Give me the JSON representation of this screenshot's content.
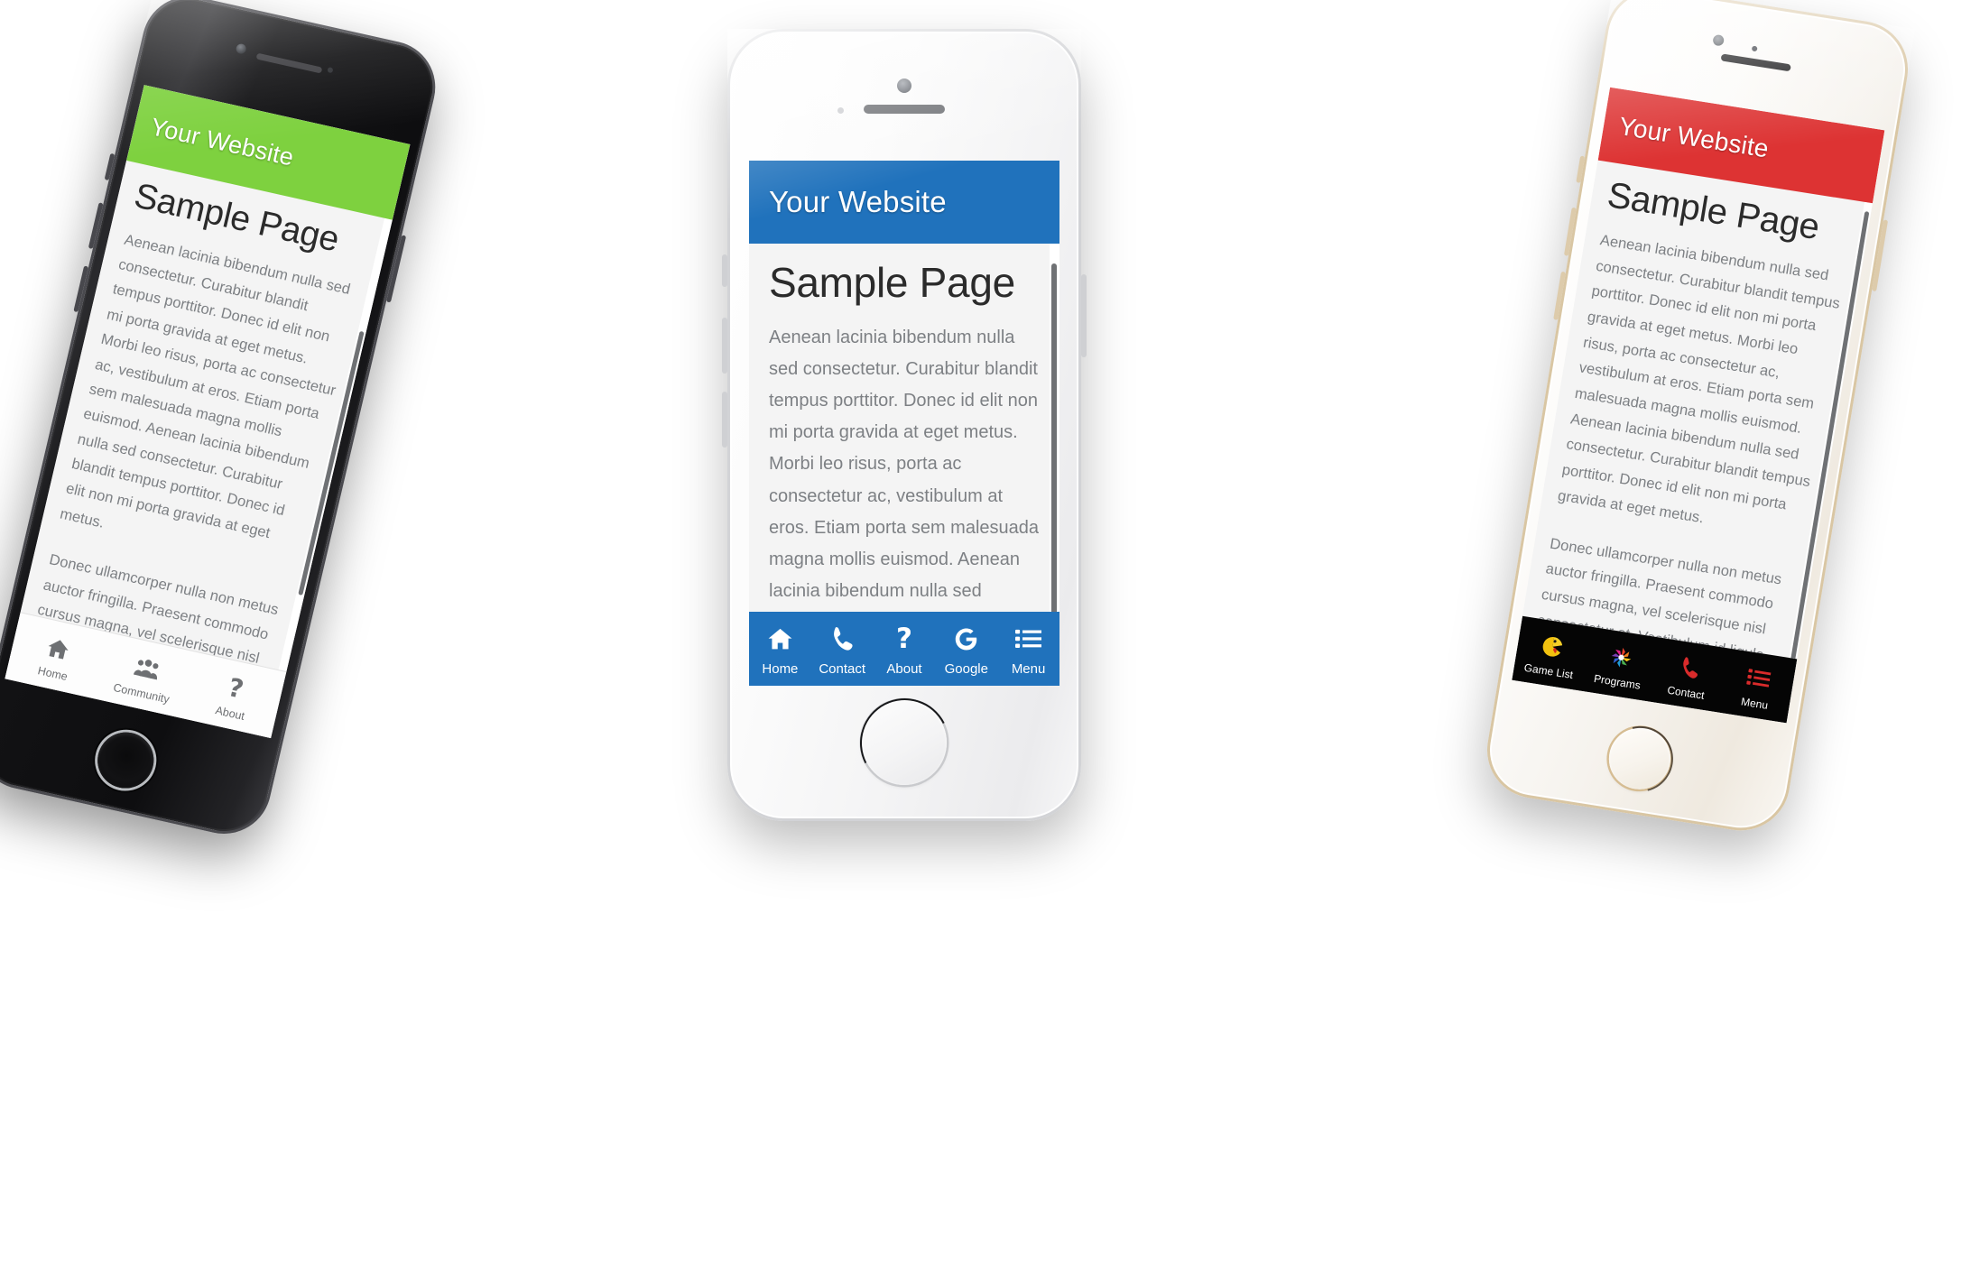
{
  "shared": {
    "site_title": "Your Website",
    "page_heading": "Sample Page",
    "paragraph_1": "Aenean lacinia bibendum nulla sed consectetur. Curabitur blandit tempus porttitor. Donec id elit non mi porta gravida at eget metus. Morbi leo risus, porta ac consectetur ac, vestibulum at eros. Etiam porta sem malesuada magna mollis euismod. Aenean lacinia bibendum nulla sed consectetur. Curabitur blandit tempus porttitor. Donec id elit non mi porta gravida at eget metus.",
    "paragraph_2": "Donec ullamcorper nulla non metus auctor fringilla. Praesent commodo cursus magna, vel scelerisque nisl consectetur et. Vestibulum id ligula porta felis euismod semper. Integer posuere erat a ante venenatis dapibus posuere velit aliquet. Donec id elit non mi porta gravida at eget metus."
  },
  "phones": {
    "left": {
      "device_name": "iPhone Space Gray",
      "device_color": "#1a1a1c",
      "header_color": "#7ed13f",
      "title": "Your Website",
      "heading": "Sample Page",
      "navbar_bg": "#fdfdfd",
      "navbar_text_color": "#6e7073",
      "nav": [
        {
          "label": "Home",
          "icon": "home-icon"
        },
        {
          "label": "Community",
          "icon": "community-icon"
        },
        {
          "label": "About",
          "icon": "question-mark-icon"
        }
      ]
    },
    "center": {
      "device_name": "iPhone Silver",
      "device_color": "#f4f4f5",
      "header_color": "#2072bc",
      "title": "Your Website",
      "heading": "Sample Page",
      "navbar_bg": "#2072bc",
      "navbar_text_color": "#ffffff",
      "nav": [
        {
          "label": "Home",
          "icon": "home-icon"
        },
        {
          "label": "Contact",
          "icon": "phone-icon"
        },
        {
          "label": "About",
          "icon": "question-mark-icon"
        },
        {
          "label": "Google",
          "icon": "google-g-icon"
        },
        {
          "label": "Menu",
          "icon": "list-menu-icon"
        }
      ]
    },
    "right": {
      "device_name": "iPhone Gold",
      "device_color": "#f6f3ee",
      "header_color": "#dd3333",
      "title": "Your Website",
      "heading": "Sample Page",
      "navbar_bg": "#050505",
      "navbar_text_color": "#ffffff",
      "nav": [
        {
          "label": "Game List",
          "icon": "pacman-icon"
        },
        {
          "label": "Programs",
          "icon": "pinwheel-icon"
        },
        {
          "label": "Contact",
          "icon": "phone-icon"
        },
        {
          "label": "Menu",
          "icon": "list-menu-icon"
        }
      ]
    }
  }
}
